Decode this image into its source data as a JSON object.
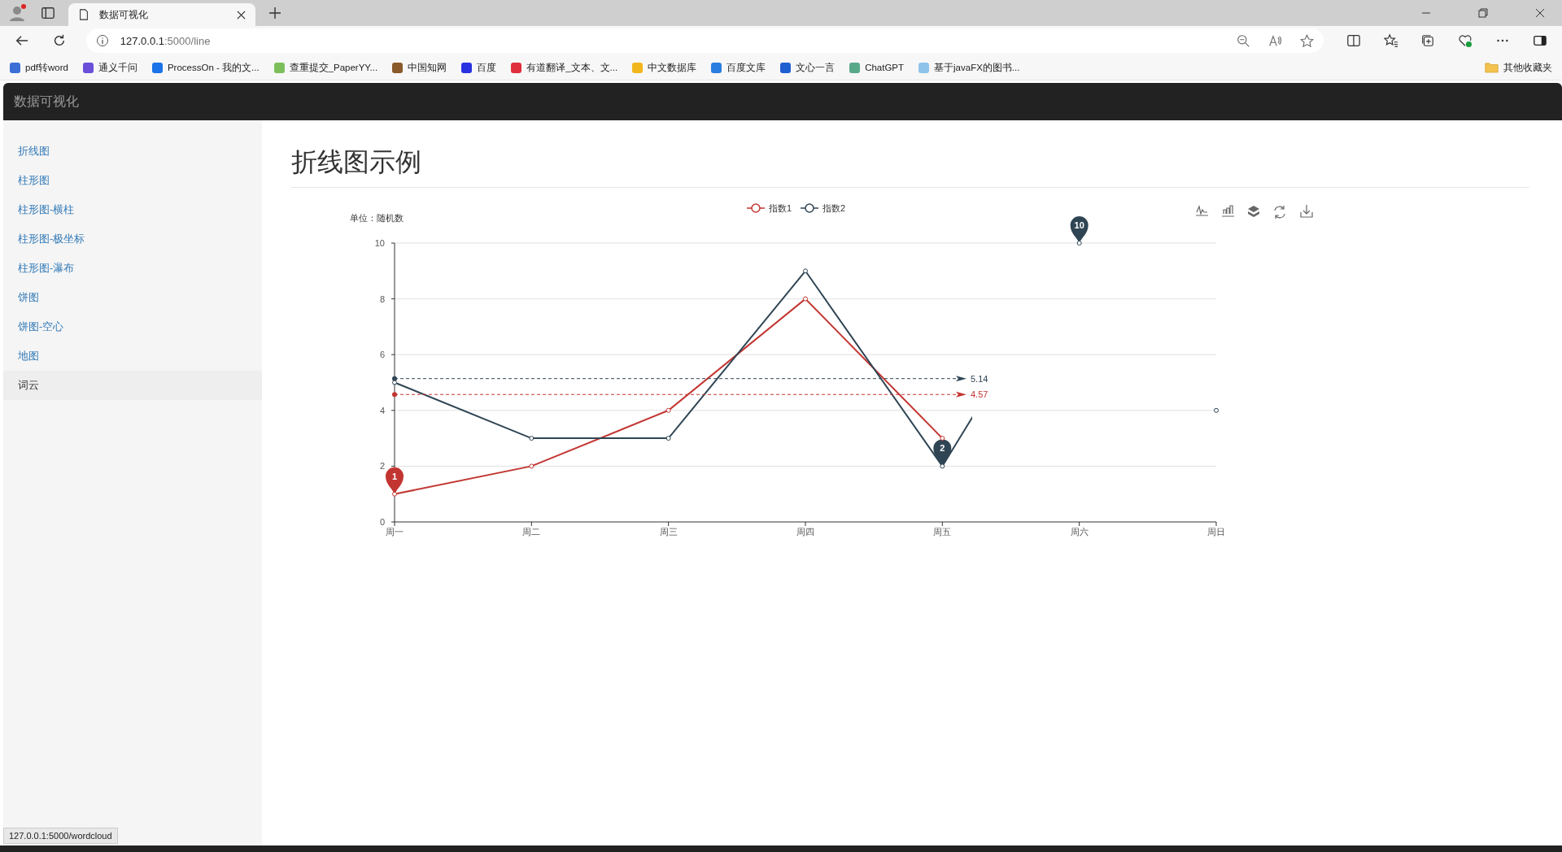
{
  "browser": {
    "tab": {
      "title": "数据可视化"
    },
    "address": {
      "host": "127.0.0.1",
      "path": ":5000/line"
    },
    "bookmarks": [
      {
        "label": "pdf转word",
        "color": "#3b6fd6"
      },
      {
        "label": "通义千问",
        "color": "#6a4fd8"
      },
      {
        "label": "ProcessOn - 我的文...",
        "color": "#1a73e8"
      },
      {
        "label": "查重提交_PaperYY...",
        "color": "#7cbf5a"
      },
      {
        "label": "中国知网",
        "color": "#8a5a2b"
      },
      {
        "label": "百度",
        "color": "#2932e1"
      },
      {
        "label": "有道翻译_文本、文...",
        "color": "#e02e3c"
      },
      {
        "label": "中文数据库",
        "color": "#f2b61d"
      },
      {
        "label": "百度文库",
        "color": "#2a7de1"
      },
      {
        "label": "文心一言",
        "color": "#1f5fd0"
      },
      {
        "label": "ChatGPT",
        "color": "#5aa88a"
      },
      {
        "label": "基于javaFX的图书...",
        "color": "#8fc3ea"
      }
    ],
    "other_bookmarks": "其他收藏夹"
  },
  "navbar": {
    "brand": "数据可视化"
  },
  "sidebar": {
    "items": [
      {
        "label": "折线图",
        "selected": false
      },
      {
        "label": "柱形图",
        "selected": false
      },
      {
        "label": "柱形图-横柱",
        "selected": false
      },
      {
        "label": "柱形图-极坐标",
        "selected": false
      },
      {
        "label": "柱形图-瀑布",
        "selected": false
      },
      {
        "label": "饼图",
        "selected": false
      },
      {
        "label": "饼图-空心",
        "selected": false
      },
      {
        "label": "地图",
        "selected": false
      },
      {
        "label": "词云",
        "selected": true
      }
    ]
  },
  "main": {
    "title": "折线图示例",
    "chart_data": {
      "type": "line",
      "ylabel": "单位：随机数",
      "categories": [
        "周一",
        "周二",
        "周三",
        "周四",
        "周五",
        "周六",
        "周日"
      ],
      "series": [
        {
          "name": "指数1",
          "color": "#c23531",
          "marker": "circle",
          "values": [
            1,
            2,
            4,
            8,
            3,
            null,
            null
          ]
        },
        {
          "name": "指数2",
          "color": "#2f4554",
          "marker": "circle",
          "values": [
            5,
            3,
            3,
            9,
            2,
            10,
            4
          ]
        }
      ],
      "ylim": [
        0,
        10
      ],
      "yticks": [
        0,
        2,
        4,
        6,
        8,
        10
      ],
      "grid": true,
      "legend": "top",
      "annotations": [
        {
          "text": "1",
          "x": "周一",
          "y": 1
        },
        {
          "text": "2",
          "x": "周五",
          "y": 2
        },
        {
          "text": "10",
          "x": "周六",
          "y": 10
        }
      ],
      "ref_lines": [
        {
          "label": "5.14",
          "color": "#2f4554"
        },
        {
          "label": "4.57",
          "color": "#c23531"
        }
      ]
    }
  },
  "status_link": "127.0.0.1:5000/wordcloud"
}
